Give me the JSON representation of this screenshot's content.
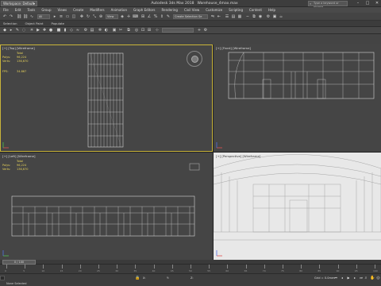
{
  "titlebar": {
    "workspace": "Workspace: Default",
    "app": "Autodesk 3ds Max 2018",
    "file": "Warehouse_4max.max",
    "search_placeholder": "Type a keyword or phrase"
  },
  "menu": [
    "File",
    "Edit",
    "Tools",
    "Group",
    "Views",
    "Create",
    "Modifiers",
    "Animation",
    "Graph Editors",
    "Rendering",
    "Civil View",
    "Customize",
    "Scripting",
    "Content",
    "Help"
  ],
  "toolbar": {
    "selection_filter": "All",
    "view_dropdown": "View",
    "named_set": "Create Selection Se"
  },
  "ribbon_tabs": [
    "Selection",
    "Object Paint",
    "Populate"
  ],
  "viewports": {
    "top_left": {
      "label": "[+] [Top] [Wireframe]",
      "total": "Total",
      "polys_label": "Polys:",
      "polys": "96,224",
      "verts_label": "Verts:",
      "verts": "136,670",
      "fps_label": "FPS:",
      "fps": "34.867"
    },
    "top_right": {
      "label": "[+] [Front] [Wireframe]"
    },
    "bottom_left": {
      "label": "[+] [Left] [Wireframe]",
      "total": "Total",
      "polys_label": "Polys:",
      "polys": "96,224",
      "verts_label": "Verts:",
      "verts": "136,670"
    },
    "bottom_right": {
      "label": "[+] [Perspective] [Wireframe]"
    }
  },
  "timeline": {
    "frame": "0 / 100",
    "ticks": [
      "0",
      "5",
      "10",
      "15",
      "20",
      "25",
      "30",
      "35",
      "40",
      "45",
      "50",
      "55",
      "60",
      "65",
      "70",
      "75",
      "80",
      "85",
      "90",
      "95",
      "100"
    ]
  },
  "status": {
    "selection": "None Selected",
    "grid": "Grid = 0.0mm"
  },
  "colors": {
    "active_border": "#c9b43a",
    "stats_text": "#e6d25a",
    "wire": "#d8d8d8"
  }
}
